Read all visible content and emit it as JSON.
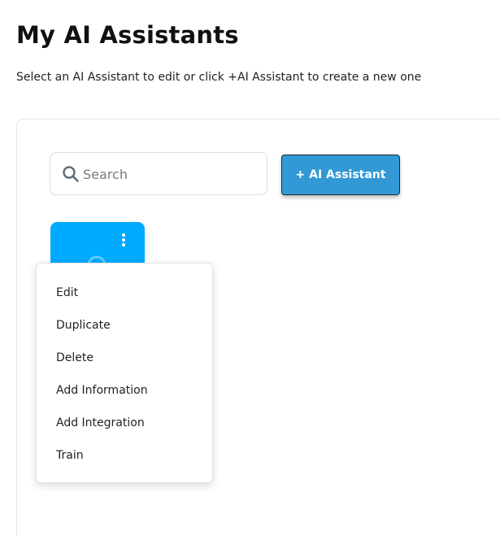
{
  "header": {
    "title": "My AI Assistants",
    "subtitle": "Select an AI Assistant to edit or click +AI Assistant to create a new one"
  },
  "toolbar": {
    "search_placeholder": "Search",
    "search_value": "",
    "add_button_label": "+ AI Assistant"
  },
  "colors": {
    "accent": "#3399d6",
    "card": "#00aaff"
  },
  "assistant_card": {
    "menu_icon": "kebab-vertical-icon",
    "center_icon": "loading-spinner-icon"
  },
  "context_menu": {
    "items": [
      {
        "label": "Edit"
      },
      {
        "label": "Duplicate"
      },
      {
        "label": "Delete"
      },
      {
        "label": "Add Information"
      },
      {
        "label": "Add Integration"
      },
      {
        "label": "Train"
      }
    ]
  }
}
